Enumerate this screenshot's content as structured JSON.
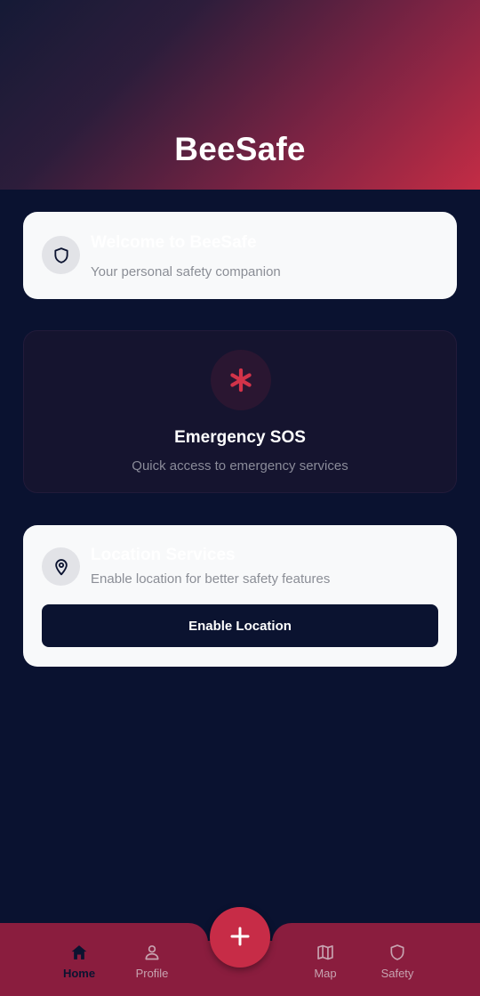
{
  "header": {
    "title": "BeeSafe"
  },
  "welcome_card": {
    "title": "Welcome to BeeSafe",
    "subtitle": "Your personal safety companion",
    "icon": "shield-icon"
  },
  "sos_card": {
    "title": "Emergency SOS",
    "subtitle": "Quick access to emergency services",
    "icon": "asterisk-icon"
  },
  "location_card": {
    "title": "Location Services",
    "subtitle": "Enable location for better safety features",
    "icon": "location-pin-icon",
    "button_label": "Enable Location"
  },
  "bottom_nav": {
    "items": [
      {
        "label": "Home",
        "icon": "home-icon",
        "active": true
      },
      {
        "label": "Profile",
        "icon": "person-icon",
        "active": false
      },
      {
        "label": "Map",
        "icon": "map-icon",
        "active": false
      },
      {
        "label": "Safety",
        "icon": "shield-icon",
        "active": false
      }
    ],
    "fab_icon": "plus-icon"
  },
  "colors": {
    "background": "#0a1230",
    "accent": "#c72c47",
    "nav_background": "#8a1d3e",
    "card_background": "#f8f9fa"
  }
}
